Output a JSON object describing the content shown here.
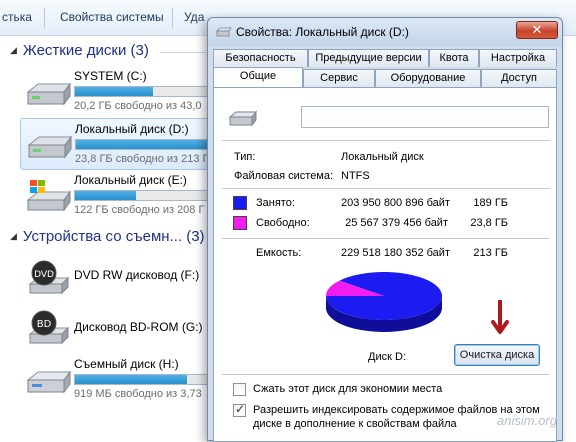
{
  "explorer": {
    "toolbar": {
      "organize_label": "стька",
      "system_props_label": "Свойства системы",
      "uninstall_label": "Уда"
    },
    "hard_drives_header": "Жесткие диски (3)",
    "removable_header": "Устройства со съемн... (3)",
    "drives": [
      {
        "name": "SYSTEM (C:)",
        "info": "20,2 ГБ свободно из 43,0",
        "used_fraction": 0.53,
        "icon": "hard-drive-icon"
      },
      {
        "name": "Локальный диск (D:)",
        "info": "23,8 ГБ свободно из 213 Г",
        "used_fraction": 0.89,
        "icon": "hard-drive-icon"
      },
      {
        "name": "Локальный диск (E:)",
        "info": "122 ГБ свободно из 208 Г",
        "used_fraction": 0.41,
        "icon": "windows-drive-icon"
      }
    ],
    "devices": [
      {
        "name": "DVD RW дисковод (F:)",
        "icon": "dvd-drive-icon",
        "badge": "DVD"
      },
      {
        "name": "Дисковод BD-ROM (G:)",
        "icon": "bd-drive-icon",
        "badge": "BD"
      },
      {
        "name": "Съемный диск (H:)",
        "info": "919 МБ свободно из 3,73",
        "used_fraction": 0.76,
        "icon": "usb-drive-icon"
      }
    ]
  },
  "dialog": {
    "title": "Свойства: Локальный диск (D:)",
    "close_glyph": "✕",
    "tabs_row1": [
      "Безопасность",
      "Предыдущие версии",
      "Квота",
      "Настройка"
    ],
    "tabs_row2": [
      "Общие",
      "Сервис",
      "Оборудование",
      "Доступ"
    ],
    "active_tab": "Общие",
    "name_value": "",
    "type_label": "Тип:",
    "type_value": "Локальный диск",
    "fs_label": "Файловая система:",
    "fs_value": "NTFS",
    "used_label": "Занято:",
    "used_bytes": "203 950 800 896 байт",
    "used_size": "189 ГБ",
    "free_label": "Свободно:",
    "free_bytes": "25 567 379 456 байт",
    "free_size": "23,8 ГБ",
    "capacity_label": "Емкость:",
    "capacity_bytes": "229 518 180 352 байт",
    "capacity_size": "213 ГБ",
    "disk_label": "Диск D:",
    "cleanup_button": "Очистка диска",
    "compress_label": "Сжать этот диск для экономии места",
    "compress_checked": false,
    "index_label_line1": "Разрешить индексировать содержимое файлов на этом",
    "index_label_line2": "диске в дополнение к свойствам файла",
    "index_checked": true,
    "used_fraction": 0.889
  },
  "colors": {
    "used": "#1c1cf0",
    "free": "#f01cf0",
    "arrow": "#b0181d"
  },
  "watermark": "anisim.org"
}
